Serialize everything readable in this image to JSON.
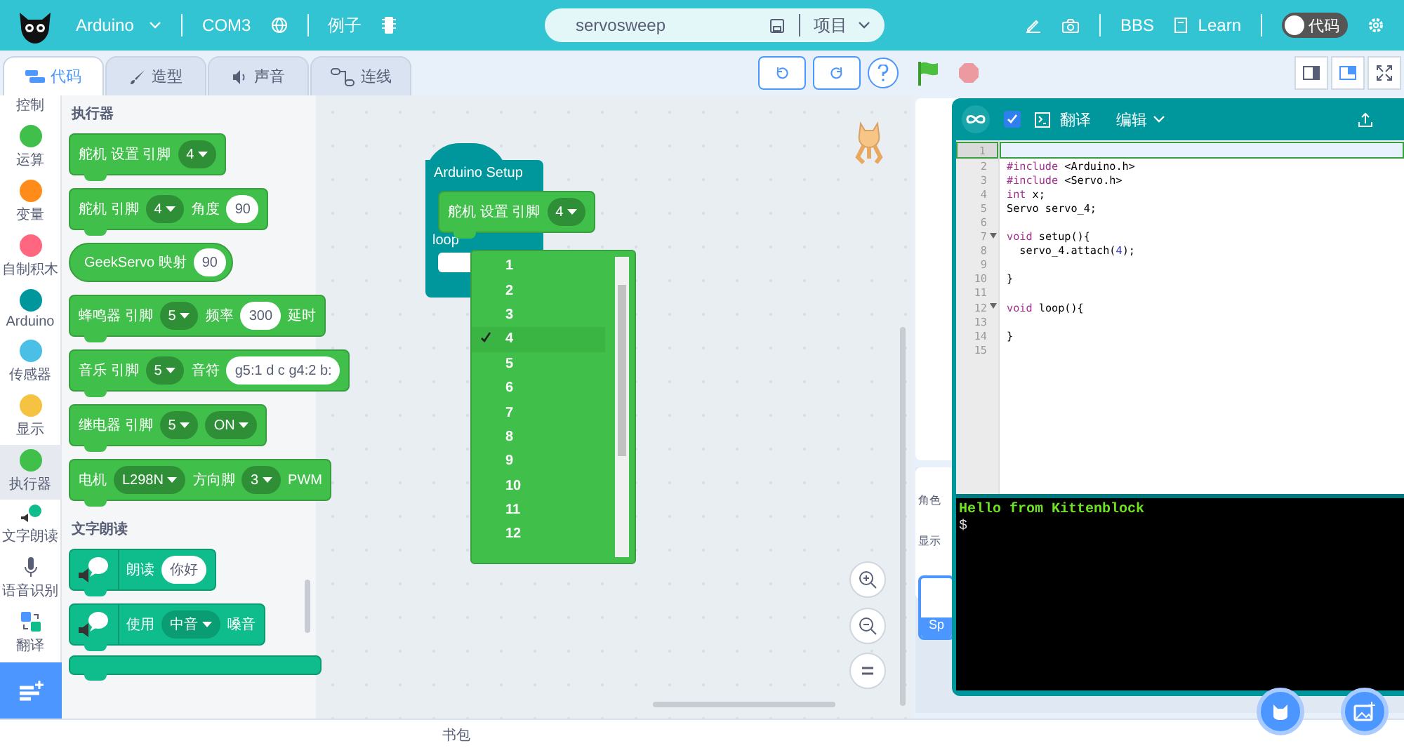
{
  "header": {
    "board": "Arduino",
    "port": "COM3",
    "examples": "例子",
    "project_name": "servosweep",
    "project_menu": "项目",
    "bbs": "BBS",
    "learn": "Learn",
    "code_toggle": "代码"
  },
  "tabs": [
    {
      "label": "代码",
      "kind": "code",
      "selected": true
    },
    {
      "label": "造型",
      "kind": "brush",
      "selected": false
    },
    {
      "label": "声音",
      "kind": "sound",
      "selected": false
    },
    {
      "label": "连线",
      "kind": "wire",
      "selected": false
    }
  ],
  "categories": [
    {
      "label": "控制",
      "kind": "none",
      "selected": false
    },
    {
      "label": "运算",
      "kind": "dot",
      "color": "#40bf4a",
      "selected": false
    },
    {
      "label": "变量",
      "kind": "dot",
      "color": "#ff8c1a",
      "selected": false
    },
    {
      "label": "自制积木",
      "kind": "dot",
      "color": "#ff6680",
      "selected": false
    },
    {
      "label": "Arduino",
      "kind": "dot",
      "color": "#00979c",
      "selected": false
    },
    {
      "label": "传感器",
      "kind": "dot",
      "color": "#4cbfe6",
      "selected": false
    },
    {
      "label": "显示",
      "kind": "dot",
      "color": "#f5c242",
      "selected": false
    },
    {
      "label": "执行器",
      "kind": "dot",
      "color": "#40bf4a",
      "selected": true
    },
    {
      "label": "文字朗读",
      "kind": "speech",
      "selected": false
    },
    {
      "label": "语音识别",
      "kind": "mic",
      "selected": false
    },
    {
      "label": "翻译",
      "kind": "translate",
      "selected": false
    }
  ],
  "palette": [
    {
      "title": "执行器",
      "kind": "actuator",
      "blocks": [
        {
          "kind": "stack",
          "parts": [
            {
              "kind": "text",
              "text": "舵机 设置 引脚"
            },
            {
              "kind": "dropdown",
              "text": "4"
            }
          ]
        },
        {
          "kind": "stack",
          "parts": [
            {
              "kind": "text",
              "text": "舵机 引脚"
            },
            {
              "kind": "dropdown",
              "text": "4"
            },
            {
              "kind": "text",
              "text": "角度"
            },
            {
              "kind": "input",
              "text": "90"
            }
          ]
        },
        {
          "kind": "reporter",
          "parts": [
            {
              "kind": "text",
              "text": "GeekServo 映射"
            },
            {
              "kind": "input",
              "text": "90"
            }
          ]
        },
        {
          "kind": "stack",
          "parts": [
            {
              "kind": "text",
              "text": "蜂鸣器 引脚"
            },
            {
              "kind": "dropdown",
              "text": "5"
            },
            {
              "kind": "text",
              "text": "频率"
            },
            {
              "kind": "input",
              "text": "300"
            },
            {
              "kind": "text",
              "text": "延时"
            }
          ]
        },
        {
          "kind": "stack",
          "parts": [
            {
              "kind": "text",
              "text": "音乐 引脚"
            },
            {
              "kind": "dropdown",
              "text": "5"
            },
            {
              "kind": "text",
              "text": "音符"
            },
            {
              "kind": "input",
              "text": "g5:1 d c g4:2 b:"
            }
          ]
        },
        {
          "kind": "stack",
          "parts": [
            {
              "kind": "text",
              "text": "继电器 引脚"
            },
            {
              "kind": "dropdown",
              "text": "5"
            },
            {
              "kind": "dropdown",
              "text": "ON"
            }
          ]
        },
        {
          "kind": "stack",
          "parts": [
            {
              "kind": "text",
              "text": "电机"
            },
            {
              "kind": "dropdown",
              "text": "L298N"
            },
            {
              "kind": "text",
              "text": "方向脚"
            },
            {
              "kind": "dropdown",
              "text": "3"
            },
            {
              "kind": "text",
              "text": "PWM"
            }
          ]
        }
      ]
    },
    {
      "title": "文字朗读",
      "kind": "speech",
      "blocks": [
        {
          "kind": "stack",
          "parts": [
            {
              "kind": "text",
              "text": "朗读"
            },
            {
              "kind": "input",
              "text": "你好"
            }
          ]
        },
        {
          "kind": "stack",
          "parts": [
            {
              "kind": "text",
              "text": "使用"
            },
            {
              "kind": "dropdown",
              "text": "中音"
            },
            {
              "kind": "text",
              "text": "嗓音"
            }
          ]
        },
        {
          "kind": "stack"
        }
      ]
    }
  ],
  "canvas": {
    "setup_title": "Arduino Setup",
    "inner_parts": [
      {
        "kind": "text",
        "text": "舵机 设置 引脚"
      },
      {
        "kind": "dropdown",
        "text": "4"
      }
    ],
    "loop_label": "loop",
    "menu": [
      {
        "label": "1",
        "selected": false
      },
      {
        "label": "2",
        "selected": false
      },
      {
        "label": "3",
        "selected": false
      },
      {
        "label": "4",
        "selected": true
      },
      {
        "label": "5",
        "selected": false
      },
      {
        "label": "6",
        "selected": false
      },
      {
        "label": "7",
        "selected": false
      },
      {
        "label": "8",
        "selected": false
      },
      {
        "label": "9",
        "selected": false
      },
      {
        "label": "10",
        "selected": false
      },
      {
        "label": "11",
        "selected": false
      },
      {
        "label": "12",
        "selected": false
      }
    ]
  },
  "sprite_panel": {
    "labels": [
      "角色",
      "显示"
    ],
    "sprite": "Sp"
  },
  "code_window": {
    "auto_sync": true,
    "translate": "翻译",
    "edit_menu": "编辑",
    "lines": [
      {
        "number": "1",
        "active": true,
        "fold": false
      },
      {
        "number": "2",
        "text": "#include <Arduino.h>",
        "active": false,
        "fold": false
      },
      {
        "number": "3",
        "text": "#include <Servo.h>",
        "active": false,
        "fold": false
      },
      {
        "number": "4",
        "text": "int x;",
        "active": false,
        "fold": false
      },
      {
        "number": "5",
        "text": "Servo servo_4;",
        "active": false,
        "fold": false
      },
      {
        "number": "6",
        "active": false,
        "fold": false
      },
      {
        "number": "7",
        "text": "void setup(){",
        "active": false,
        "fold": true
      },
      {
        "number": "8",
        "text": "  servo_4.attach(4);",
        "active": false,
        "fold": false
      },
      {
        "number": "9",
        "active": false,
        "fold": false
      },
      {
        "number": "10",
        "text": "}",
        "active": false,
        "fold": false
      },
      {
        "number": "11",
        "active": false,
        "fold": false
      },
      {
        "number": "12",
        "text": "void loop(){",
        "active": false,
        "fold": true
      },
      {
        "number": "13",
        "active": false,
        "fold": false
      },
      {
        "number": "14",
        "text": "}",
        "active": false,
        "fold": false
      },
      {
        "number": "15",
        "active": false,
        "fold": false
      }
    ],
    "console": [
      "Hello from Kittenblock",
      "$"
    ]
  },
  "backpack": "书包"
}
